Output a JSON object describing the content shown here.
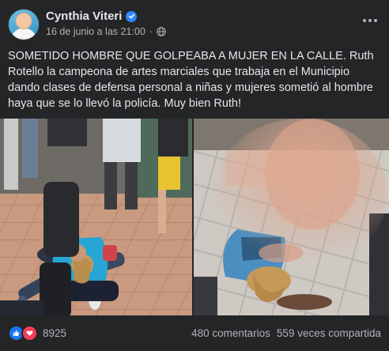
{
  "post": {
    "author": "Cynthia Viteri",
    "timestamp": "16 de junio a las 21:00",
    "privacy_icon": "globe-icon",
    "body": "SOMETIDO HOMBRE QUE GOLPEABA A MUJER EN LA CALLE. Ruth Rotello la campeona de artes marciales que trabaja en el Municipio dando clases de defensa personal a niñas y mujeres sometió al hombre haya que se lo llevó la policía. Muy bien Ruth!"
  },
  "stats": {
    "reactions": "8925",
    "comments": "480 comentarios",
    "shares": "559 veces compartida"
  },
  "colors": {
    "background": "#242526",
    "text": "#e4e6eb",
    "secondary": "#b0b3b8",
    "like": "#1877f2",
    "love": "#f33e58",
    "verified": "#2d88ff"
  }
}
